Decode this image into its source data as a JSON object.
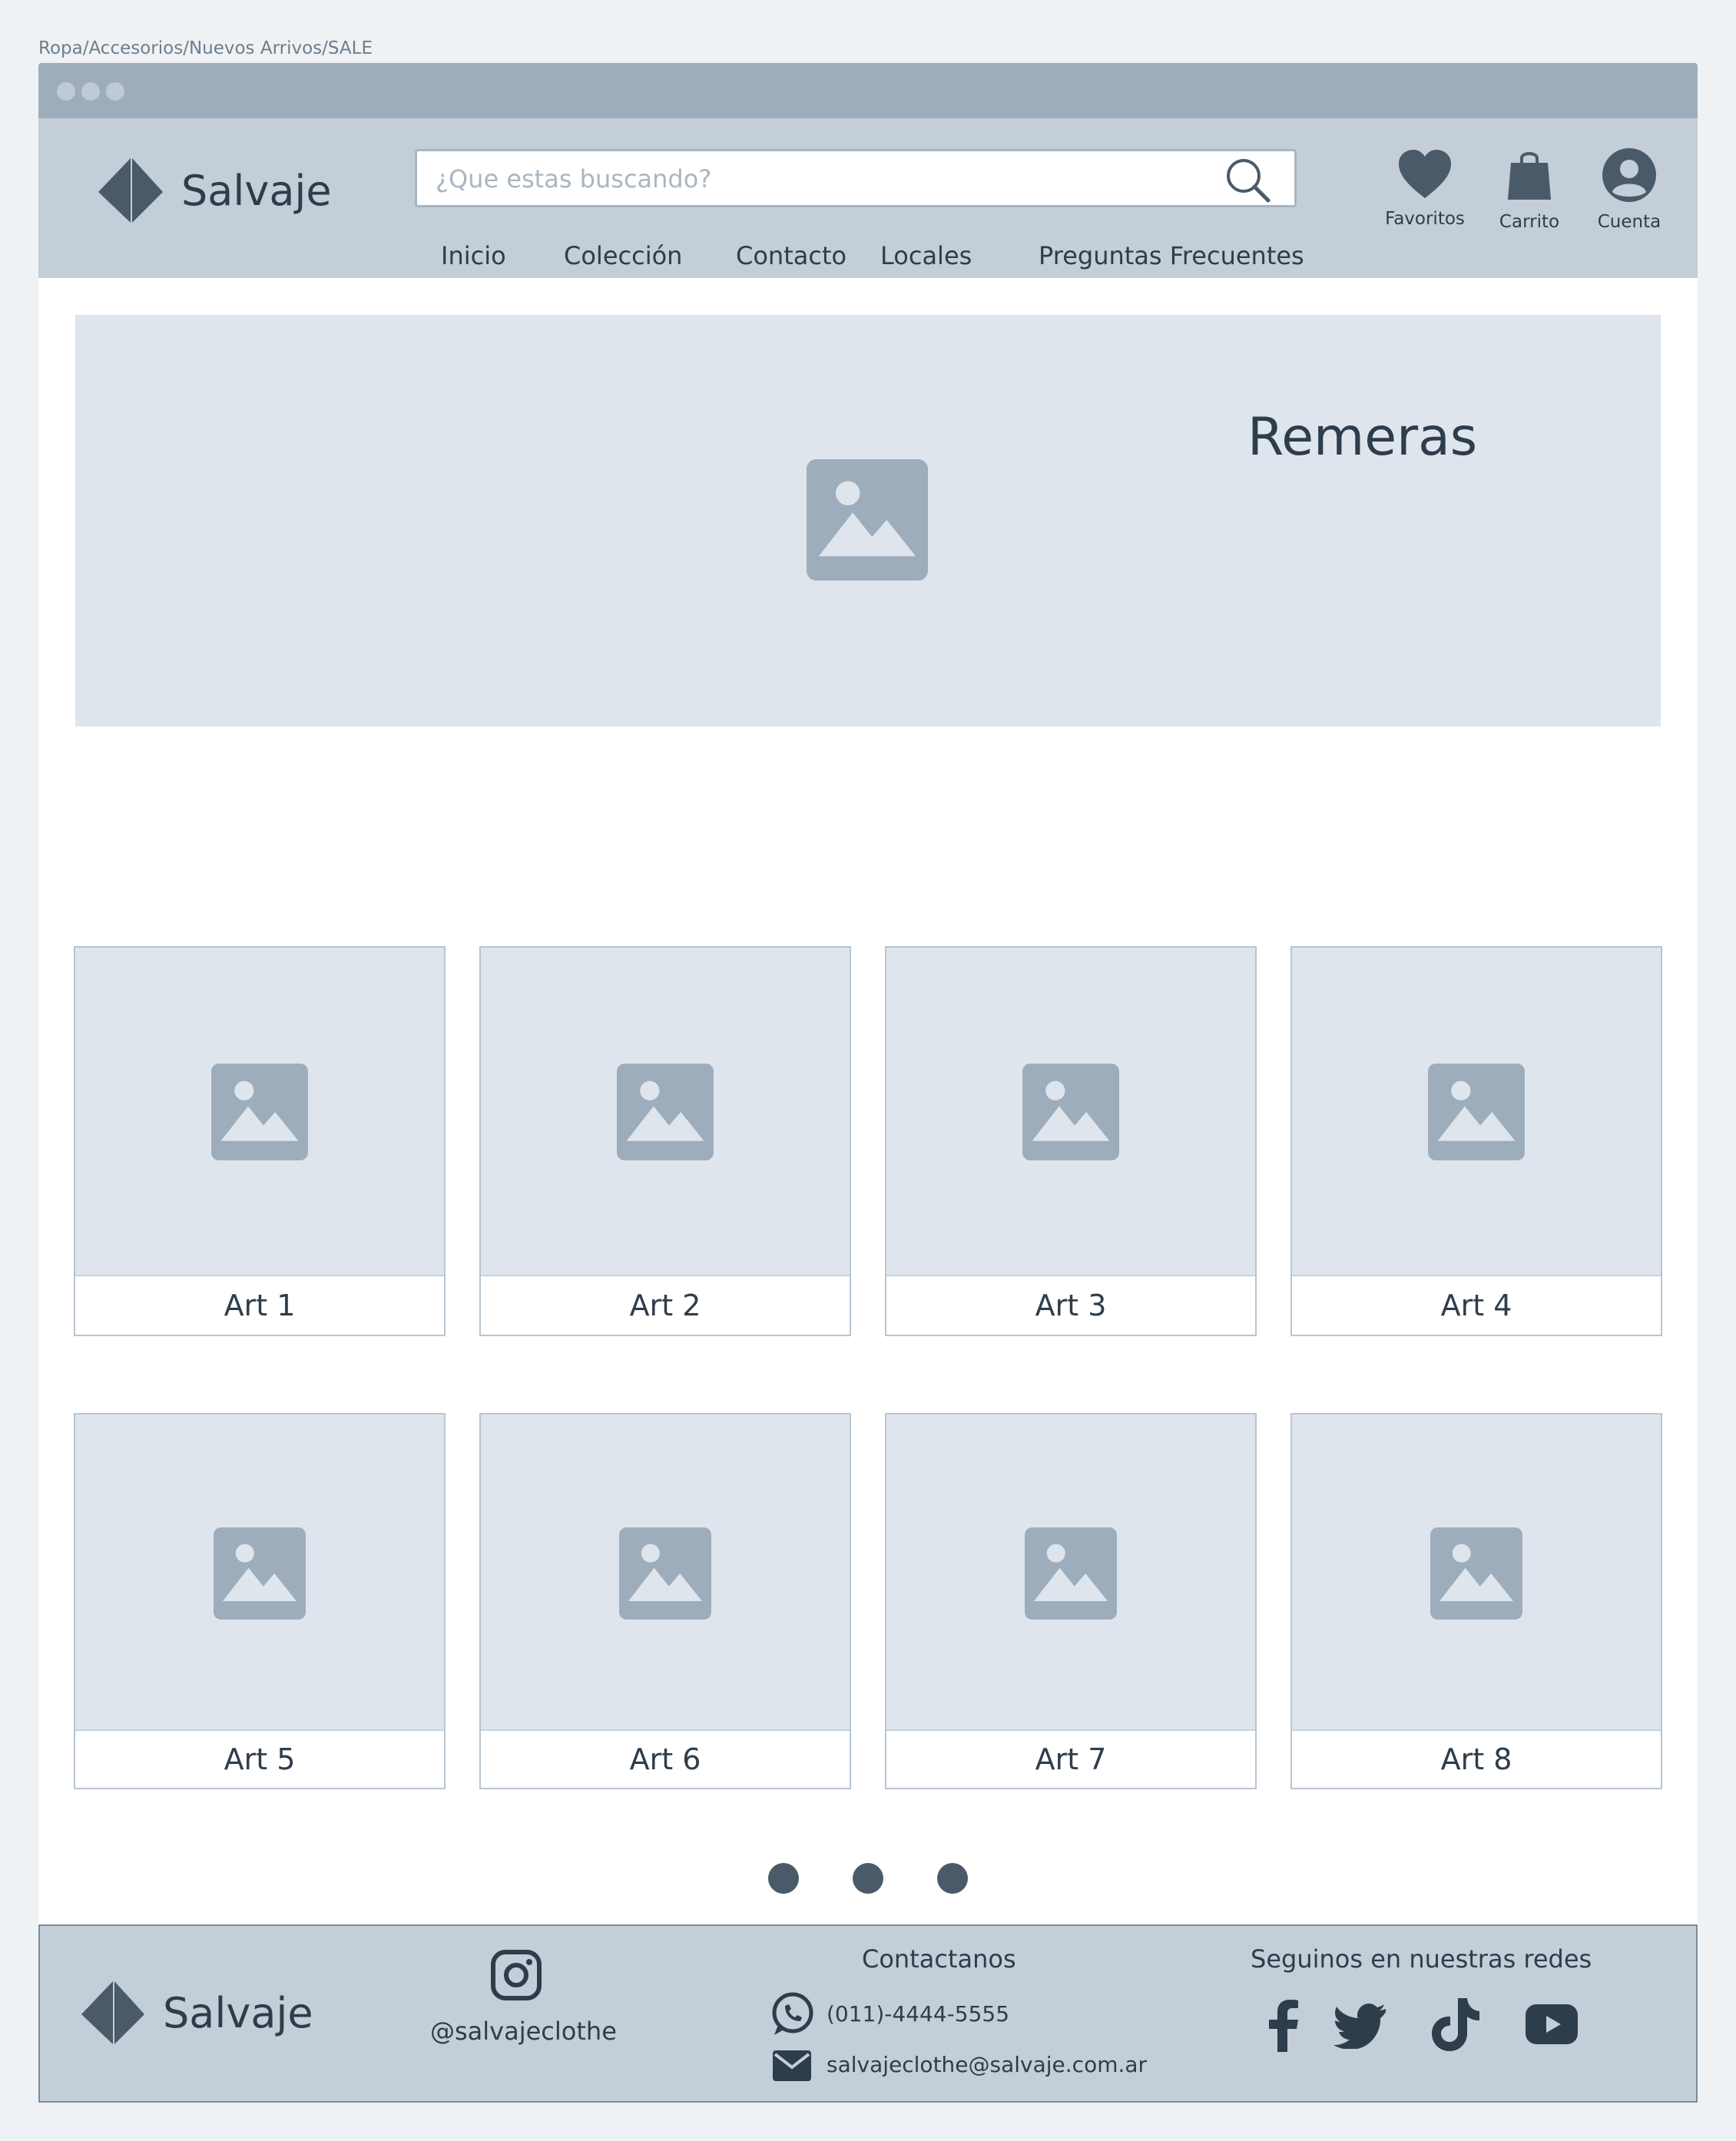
{
  "breadcrumb": "Ropa/Accesorios/Nuevos Arrivos/SALE",
  "header": {
    "brand": "Salvaje",
    "search_placeholder": "¿Que estas buscando?",
    "nav": [
      "Inicio",
      "Colección",
      "Contacto",
      "Locales",
      "Preguntas Frecuentes"
    ],
    "icons": [
      {
        "label": "Favoritos",
        "icon": "heart-icon"
      },
      {
        "label": "Carrito",
        "icon": "shopping-bag-icon"
      },
      {
        "label": "Cuenta",
        "icon": "user-icon"
      }
    ]
  },
  "banner": {
    "title": "Remeras"
  },
  "products": [
    "Art 1",
    "Art 2",
    "Art 3",
    "Art 4",
    "Art 5",
    "Art 6",
    "Art 7",
    "Art 8"
  ],
  "pagination": {
    "pages": 3
  },
  "footer": {
    "brand": "Salvaje",
    "instagram_handle": "@salvajeclothe",
    "contact_title": "Contactanos",
    "phone": "(011)-4444-5555",
    "email": "salvajeclothe@salvaje.com.ar",
    "social_title": "Seguinos en nuestras redes",
    "social_icons": [
      "facebook-icon",
      "twitter-icon",
      "tiktok-icon",
      "youtube-icon"
    ]
  },
  "colors": {
    "header_bg": "#c3ced8",
    "titlebar_bg": "#9dadbb",
    "placeholder_bg": "#dfe5ed",
    "text": "#2e3d4b",
    "accent_dark": "#4a5a69"
  }
}
